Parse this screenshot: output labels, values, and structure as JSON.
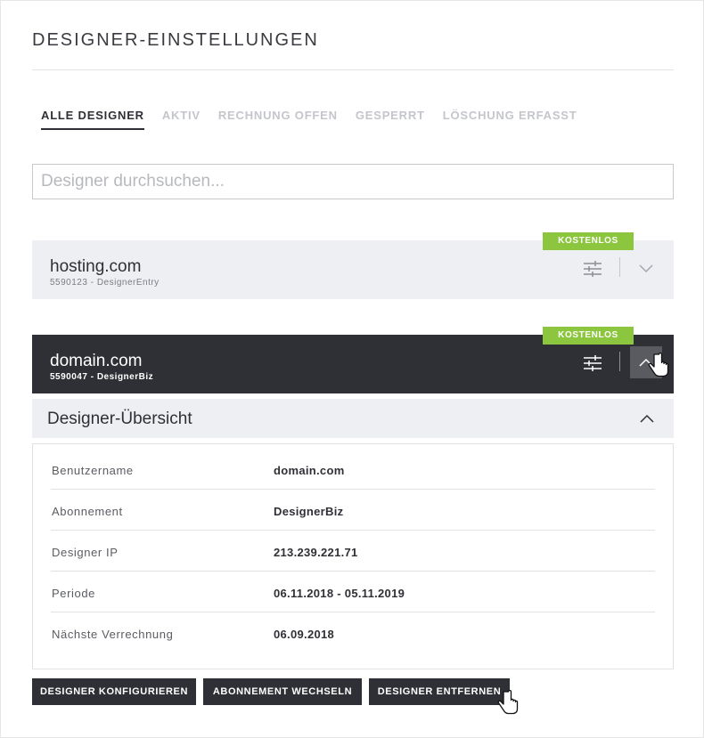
{
  "page": {
    "title": "DESIGNER-EINSTELLUNGEN"
  },
  "tabs": [
    {
      "label": "ALLE DESIGNER",
      "active": true
    },
    {
      "label": "AKTIV"
    },
    {
      "label": "RECHNUNG OFFEN"
    },
    {
      "label": "GESPERRT"
    },
    {
      "label": "LÖSCHUNG ERFASST"
    }
  ],
  "search": {
    "placeholder": "Designer durchsuchen...",
    "value": ""
  },
  "entries": [
    {
      "name": "hosting.com",
      "sub": "5590123 - DesignerEntry",
      "badge": "KOSTENLOS",
      "expanded": false
    },
    {
      "name": "domain.com",
      "sub": "5590047 - DesignerBiz",
      "badge": "KOSTENLOS",
      "expanded": true
    }
  ],
  "overview": {
    "title": "Designer-Übersicht",
    "rows": [
      {
        "label": "Benutzername",
        "value": "domain.com"
      },
      {
        "label": "Abonnement",
        "value": "DesignerBiz"
      },
      {
        "label": "Designer IP",
        "value": "213.239.221.71"
      },
      {
        "label": "Periode",
        "value": "06.11.2018 - 05.11.2019"
      },
      {
        "label": "Nächste Verrechnung",
        "value": "06.09.2018"
      }
    ]
  },
  "actions": {
    "configure": "DESIGNER KONFIGURIEREN",
    "change_subscription": "ABONNEMENT WECHSELN",
    "remove": "DESIGNER ENTFERNEN"
  },
  "colors": {
    "dark": "#2f3035",
    "badge": "#8cc63f",
    "panel": "#eeeff2",
    "muted_tab": "#c4c6cc"
  },
  "icons": [
    "sliders-icon",
    "chevron-down-icon",
    "chevron-up-icon",
    "hand-cursor-icon"
  ]
}
